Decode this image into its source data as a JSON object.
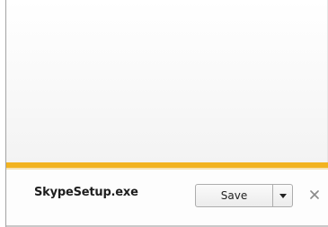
{
  "download_bar": {
    "file_name": "SkypeSetup.exe",
    "save_label": "Save",
    "accent_color": "#f2b320",
    "dropdown_icon": "chevron-down-icon",
    "close_icon": "close-icon"
  }
}
